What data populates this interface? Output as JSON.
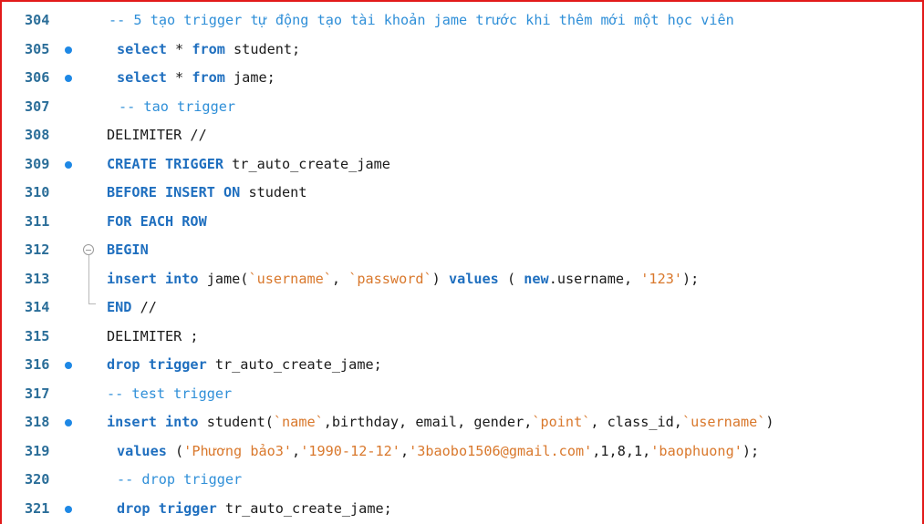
{
  "editor": {
    "lines": [
      {
        "num": "304",
        "breakpoint": false,
        "tokens": [
          {
            "t": "-- 5 tạo trigger tự động tạo tài khoản jame trước khi thêm mới một học viên",
            "c": "cm"
          }
        ]
      },
      {
        "num": "305",
        "breakpoint": true,
        "tokens": [
          {
            "t": "select",
            "c": "kw"
          },
          {
            "t": " * ",
            "c": "op"
          },
          {
            "t": "from",
            "c": "kw"
          },
          {
            "t": " student;",
            "c": "id"
          }
        ]
      },
      {
        "num": "306",
        "breakpoint": true,
        "tokens": [
          {
            "t": "select",
            "c": "kw"
          },
          {
            "t": " * ",
            "c": "op"
          },
          {
            "t": "from",
            "c": "kw"
          },
          {
            "t": " jame;",
            "c": "id"
          }
        ]
      },
      {
        "num": "307",
        "breakpoint": false,
        "tokens": [
          {
            "t": "-- tao trigger",
            "c": "cm"
          }
        ]
      },
      {
        "num": "308",
        "breakpoint": false,
        "tokens": [
          {
            "t": "DELIMITER //",
            "c": "id"
          }
        ]
      },
      {
        "num": "309",
        "breakpoint": true,
        "tokens": [
          {
            "t": "CREATE TRIGGER",
            "c": "kw"
          },
          {
            "t": " tr_auto_create_jame",
            "c": "id"
          }
        ]
      },
      {
        "num": "310",
        "breakpoint": false,
        "tokens": [
          {
            "t": "BEFORE INSERT ON",
            "c": "kw"
          },
          {
            "t": " student",
            "c": "id"
          }
        ]
      },
      {
        "num": "311",
        "breakpoint": false,
        "tokens": [
          {
            "t": "FOR EACH ROW",
            "c": "kw"
          }
        ]
      },
      {
        "num": "312",
        "breakpoint": false,
        "fold": "start",
        "tokens": [
          {
            "t": "BEGIN",
            "c": "kw"
          }
        ]
      },
      {
        "num": "313",
        "breakpoint": false,
        "tokens": [
          {
            "t": "insert into",
            "c": "kw"
          },
          {
            "t": " jame(",
            "c": "id"
          },
          {
            "t": "`username`",
            "c": "st"
          },
          {
            "t": ", ",
            "c": "op"
          },
          {
            "t": "`password`",
            "c": "st"
          },
          {
            "t": ") ",
            "c": "op"
          },
          {
            "t": "values",
            "c": "kw"
          },
          {
            "t": " ( ",
            "c": "op"
          },
          {
            "t": "new",
            "c": "kw"
          },
          {
            "t": ".username, ",
            "c": "id"
          },
          {
            "t": "'123'",
            "c": "st"
          },
          {
            "t": ");",
            "c": "op"
          }
        ]
      },
      {
        "num": "314",
        "breakpoint": false,
        "fold": "end",
        "tokens": [
          {
            "t": "END",
            "c": "kw"
          },
          {
            "t": " //",
            "c": "id"
          }
        ]
      },
      {
        "num": "315",
        "breakpoint": false,
        "tokens": [
          {
            "t": "DELIMITER ;",
            "c": "id"
          }
        ]
      },
      {
        "num": "316",
        "breakpoint": true,
        "tokens": [
          {
            "t": "drop trigger",
            "c": "kw"
          },
          {
            "t": " tr_auto_create_jame;",
            "c": "id"
          }
        ]
      },
      {
        "num": "317",
        "breakpoint": false,
        "tokens": [
          {
            "t": "-- test trigger",
            "c": "cm"
          }
        ]
      },
      {
        "num": "318",
        "breakpoint": true,
        "tokens": [
          {
            "t": "insert into",
            "c": "kw"
          },
          {
            "t": " student(",
            "c": "id"
          },
          {
            "t": "`name`",
            "c": "st"
          },
          {
            "t": ",birthday, email, gender,",
            "c": "id"
          },
          {
            "t": "`point`",
            "c": "st"
          },
          {
            "t": ", class_id,",
            "c": "id"
          },
          {
            "t": "`username`",
            "c": "st"
          },
          {
            "t": ")",
            "c": "op"
          }
        ]
      },
      {
        "num": "319",
        "breakpoint": false,
        "tokens": [
          {
            "t": "values",
            "c": "kw"
          },
          {
            "t": " (",
            "c": "op"
          },
          {
            "t": "'Phương bảo3'",
            "c": "st"
          },
          {
            "t": ",",
            "c": "op"
          },
          {
            "t": "'1990-12-12'",
            "c": "st"
          },
          {
            "t": ",",
            "c": "op"
          },
          {
            "t": "'3baobo1506@gmail.com'",
            "c": "st"
          },
          {
            "t": ",1,8,1,",
            "c": "op"
          },
          {
            "t": "'baophuong'",
            "c": "st"
          },
          {
            "t": ");",
            "c": "op"
          }
        ]
      },
      {
        "num": "320",
        "breakpoint": false,
        "tokens": [
          {
            "t": "-- drop trigger",
            "c": "cm"
          }
        ]
      },
      {
        "num": "321",
        "breakpoint": true,
        "tokens": [
          {
            "t": "drop trigger",
            "c": "kw"
          },
          {
            "t": " tr_auto_create_jame;",
            "c": "id"
          }
        ]
      }
    ]
  }
}
